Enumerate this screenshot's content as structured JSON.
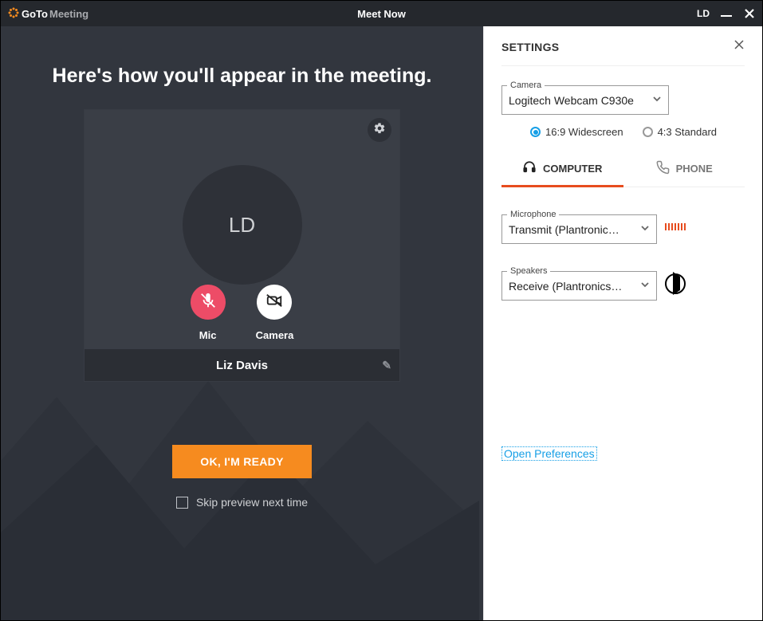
{
  "titlebar": {
    "brand_goto": "GoTo",
    "brand_meeting": "Meeting",
    "title": "Meet Now",
    "user_initials": "LD"
  },
  "preview": {
    "heading": "Here's how you'll appear in the meeting.",
    "avatar_initials": "LD",
    "mic_label": "Mic",
    "camera_label": "Camera",
    "user_name": "Liz Davis"
  },
  "actions": {
    "ready_button": "OK, I'M READY",
    "skip_label": "Skip preview next time"
  },
  "settings": {
    "panel_title": "SETTINGS",
    "camera_legend": "Camera",
    "camera_value": "Logitech Webcam C930e",
    "aspect_wide": "16:9 Widescreen",
    "aspect_std": "4:3 Standard",
    "tab_computer": "COMPUTER",
    "tab_phone": "PHONE",
    "mic_legend": "Microphone",
    "mic_value": "Transmit (Plantronics Savi…",
    "speakers_legend": "Speakers",
    "speakers_value": "Receive (Plantronics Savi …",
    "open_preferences": "Open Preferences"
  }
}
